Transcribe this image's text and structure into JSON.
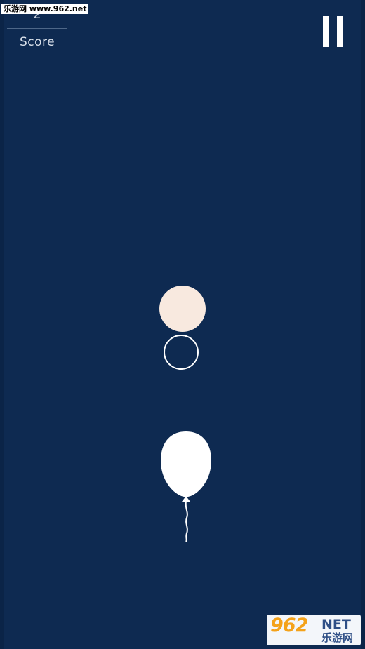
{
  "watermark_top": {
    "text": "乐游网 www.962.net"
  },
  "score": {
    "value": "2",
    "label": "Score"
  },
  "pause": {
    "icon": "pause-icon"
  },
  "orbs": {
    "filled_color": "#f8e9df",
    "ring_color": "#ffffff"
  },
  "balloon": {
    "icon": "balloon-icon",
    "color": "#ffffff"
  },
  "watermark_bottom": {
    "number": "962",
    "net": "NET",
    "cn": "乐游网"
  },
  "colors": {
    "background": "#0e2a51",
    "accent": "#f4a21a"
  }
}
